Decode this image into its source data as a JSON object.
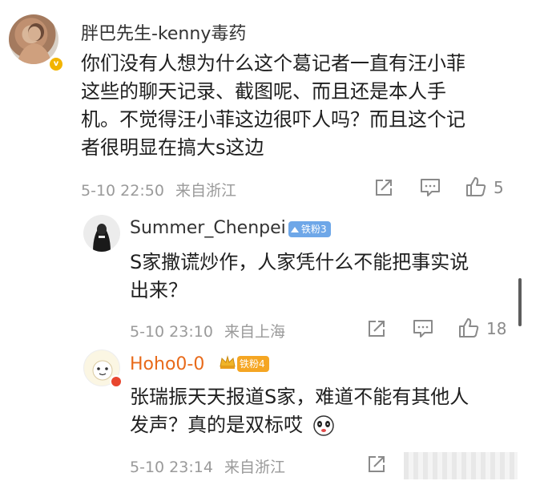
{
  "comments": [
    {
      "username": "胖巴先生-kenny毒药",
      "text_lines": [
        "你们没有人想为什么这个葛记者一直有汪小菲",
        "这些的聊天记录、截图呢、而且还是本人手",
        "机。不觉得汪小菲这边很吓人吗？而且这个记",
        "者很明显在搞大s这边"
      ],
      "date": "5-10 22:50",
      "location": "来自浙江",
      "likes": "5",
      "colors": {
        "username": "#333333"
      }
    }
  ],
  "replies": [
    {
      "username": "Summer_Chenpei",
      "badge": "铁粉3",
      "text_lines": [
        "S家撒谎炒作，人家凭什么不能把事实说",
        "出来？"
      ],
      "date": "5-10 23:10",
      "location": "来自上海",
      "likes": "18",
      "colors": {
        "badge": "#6ea7e8"
      }
    },
    {
      "username": "Hoho0-0",
      "badge": "铁粉4",
      "text_lines": [
        "张瑞振天天报道S家，难道不能有其他人",
        "发声？真的是双标哎"
      ],
      "date": "5-10 23:14",
      "location": "来自浙江",
      "colors": {
        "username": "#e86a1a",
        "badge": "#f5a623"
      }
    }
  ],
  "icons": {
    "share": "share-icon",
    "comment": "comment-icon",
    "like": "thumbs-up-icon"
  }
}
